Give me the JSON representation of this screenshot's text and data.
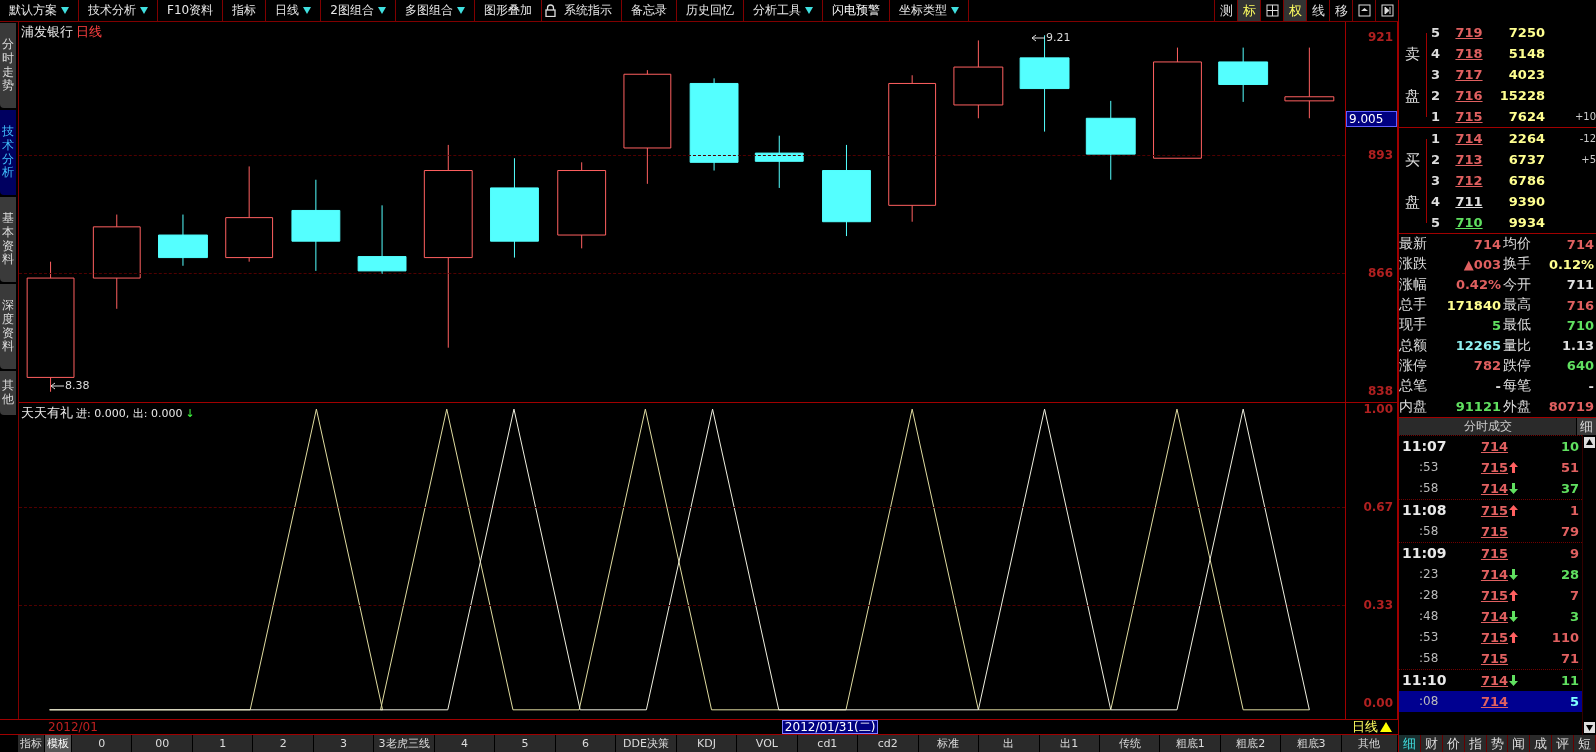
{
  "toolbar": {
    "items": [
      {
        "label": "默认方案",
        "dropdown": true
      },
      {
        "label": "技术分析",
        "dropdown": true
      },
      {
        "label": "F10资料",
        "dropdown": false
      },
      {
        "label": "指标",
        "dropdown": false
      },
      {
        "label": "日线",
        "dropdown": true
      },
      {
        "label": "2图组合",
        "dropdown": true
      },
      {
        "label": "多图组合",
        "dropdown": true
      },
      {
        "label": "图形叠加",
        "dropdown": false
      },
      {
        "label": "系统指示",
        "dropdown": false,
        "lock": true
      },
      {
        "label": "备忘录",
        "dropdown": false
      },
      {
        "label": "历史回忆",
        "dropdown": false
      },
      {
        "label": "分析工具",
        "dropdown": true
      },
      {
        "label": "闪电预警",
        "dropdown": false
      },
      {
        "label": "坐标类型",
        "dropdown": true
      }
    ],
    "right_buttons": [
      {
        "kind": "text",
        "label": "测",
        "selected": false
      },
      {
        "kind": "text",
        "label": "标",
        "selected": true
      },
      {
        "kind": "grid",
        "selected": false
      },
      {
        "kind": "text",
        "label": "权",
        "selected": true
      },
      {
        "kind": "text",
        "label": "线",
        "selected": false
      },
      {
        "kind": "text",
        "label": "移",
        "selected": false
      },
      {
        "kind": "window",
        "selected": false
      },
      {
        "kind": "end",
        "selected": false
      }
    ]
  },
  "side_tabs": [
    {
      "label": "分时走势",
      "selected": false
    },
    {
      "label": "技术分析",
      "selected": true
    },
    {
      "label": "基本资料",
      "selected": false
    },
    {
      "label": "深度资料",
      "selected": false
    },
    {
      "label": "其他",
      "selected": false
    }
  ],
  "price_chart": {
    "stock": "浦发银行",
    "period": "日线",
    "high_marker": "9.21",
    "low_marker": "8.38",
    "current_price": "9.005",
    "axis_labels": [
      "921",
      "893",
      "866",
      "838"
    ]
  },
  "indicator": {
    "name": "天天有礼",
    "legend": "进: 0.000, 出: 0.000",
    "trend_arrow": "↓",
    "axis_labels": [
      "1.00",
      "0.67",
      "0.33",
      "0.00"
    ]
  },
  "date_bar": {
    "start": "2012/01",
    "cursor": "2012/01/31(二)",
    "period": "日线"
  },
  "bottom_tabs": [
    {
      "label": "指标",
      "selected": false
    },
    {
      "label": "模板",
      "selected": true
    },
    {
      "label": "0",
      "selected": false
    },
    {
      "label": "00",
      "selected": false
    },
    {
      "label": "1",
      "selected": false
    },
    {
      "label": "2",
      "selected": false
    },
    {
      "label": "3",
      "selected": false
    },
    {
      "label": "3老虎三线",
      "selected": false
    },
    {
      "label": "4",
      "selected": false
    },
    {
      "label": "5",
      "selected": false
    },
    {
      "label": "6",
      "selected": false
    },
    {
      "label": "DDE决策",
      "selected": false
    },
    {
      "label": "KDJ",
      "selected": false
    },
    {
      "label": "VOL",
      "selected": false
    },
    {
      "label": "cd1",
      "selected": false
    },
    {
      "label": "cd2",
      "selected": false
    },
    {
      "label": "标准",
      "selected": false
    },
    {
      "label": "出",
      "selected": false
    },
    {
      "label": "出1",
      "selected": false
    },
    {
      "label": "传统",
      "selected": false
    },
    {
      "label": "粗底1",
      "selected": false
    },
    {
      "label": "粗底2",
      "selected": false
    },
    {
      "label": "粗底3",
      "selected": false
    },
    {
      "label": "其他",
      "selected": false
    }
  ],
  "order_book": {
    "sell_label": "卖盘",
    "buy_label": "买盘",
    "sell": [
      {
        "level": "5",
        "price": "719",
        "volume": "7250",
        "color": "#e06060"
      },
      {
        "level": "4",
        "price": "718",
        "volume": "5148",
        "color": "#e06060"
      },
      {
        "level": "3",
        "price": "717",
        "volume": "4023",
        "color": "#e06060"
      },
      {
        "level": "2",
        "price": "716",
        "volume": "15228",
        "color": "#e06060"
      },
      {
        "level": "1",
        "price": "715",
        "volume": "7624",
        "change": "+10",
        "color": "#e06060"
      }
    ],
    "buy": [
      {
        "level": "1",
        "price": "714",
        "volume": "2264",
        "change": "-12",
        "color": "#e06060"
      },
      {
        "level": "2",
        "price": "713",
        "volume": "6737",
        "change": "+5",
        "color": "#e06060"
      },
      {
        "level": "3",
        "price": "712",
        "volume": "6786",
        "color": "#e06060"
      },
      {
        "level": "4",
        "price": "711",
        "volume": "9390",
        "color": "#e0e0e0"
      },
      {
        "level": "5",
        "price": "710",
        "volume": "9934",
        "color": "#60e060"
      }
    ]
  },
  "quote": [
    [
      {
        "label": "最新",
        "value": "714",
        "color": "#e06060"
      },
      {
        "label": "均价",
        "value": "714",
        "color": "#e06060"
      }
    ],
    [
      {
        "label": "涨跌",
        "value": "▲003",
        "color": "#e06060"
      },
      {
        "label": "换手",
        "value": "0.12%",
        "color": "#ffff90"
      }
    ],
    [
      {
        "label": "涨幅",
        "value": "0.42%",
        "color": "#e06060"
      },
      {
        "label": "今开",
        "value": "711",
        "color": "#e0e0e0"
      }
    ],
    [
      {
        "label": "总手",
        "value": "171840",
        "color": "#ffff90"
      },
      {
        "label": "最高",
        "value": "716",
        "color": "#e06060"
      }
    ],
    [
      {
        "label": "现手",
        "value": "5",
        "color": "#60e060"
      },
      {
        "label": "最低",
        "value": "710",
        "color": "#60e060"
      }
    ],
    [
      {
        "label": "总额",
        "value": "12265",
        "color": "#90f0f0"
      },
      {
        "label": "量比",
        "value": "1.13",
        "color": "#e0e0e0"
      }
    ],
    [
      {
        "label": "涨停",
        "value": "782",
        "color": "#e06060"
      },
      {
        "label": "跌停",
        "value": "640",
        "color": "#60e060"
      }
    ],
    [
      {
        "label": "总笔",
        "value": "-",
        "color": "#e0e0e0"
      },
      {
        "label": "每笔",
        "value": "-",
        "color": "#e0e0e0"
      }
    ],
    [
      {
        "label": "内盘",
        "value": "91121",
        "color": "#60e060"
      },
      {
        "label": "外盘",
        "value": "80719",
        "color": "#e06060"
      }
    ]
  ],
  "trades": {
    "title": "分时成交",
    "detail_button": "细",
    "rows": [
      {
        "kind": "minute",
        "time": "11:07",
        "price": "714",
        "uptick": false,
        "downtick": false,
        "volume": "10",
        "color": "#60e060",
        "selected": false
      },
      {
        "kind": "second",
        "time": ":53",
        "price": "715",
        "uptick": true,
        "downtick": false,
        "volume": "51",
        "color": "#e06060",
        "selected": false
      },
      {
        "kind": "second",
        "time": ":58",
        "price": "714",
        "uptick": false,
        "downtick": true,
        "volume": "37",
        "color": "#60e060",
        "selected": false
      },
      {
        "kind": "minute",
        "time": "11:08",
        "price": "715",
        "uptick": true,
        "downtick": false,
        "volume": "1",
        "color": "#e06060",
        "selected": false
      },
      {
        "kind": "second",
        "time": ":58",
        "price": "715",
        "uptick": false,
        "downtick": false,
        "volume": "79",
        "color": "#e06060",
        "selected": false
      },
      {
        "kind": "minute",
        "time": "11:09",
        "price": "715",
        "uptick": false,
        "downtick": false,
        "volume": "9",
        "color": "#e06060",
        "selected": false
      },
      {
        "kind": "second",
        "time": ":23",
        "price": "714",
        "uptick": false,
        "downtick": true,
        "volume": "28",
        "color": "#60e060",
        "selected": false
      },
      {
        "kind": "second",
        "time": ":28",
        "price": "715",
        "uptick": true,
        "downtick": false,
        "volume": "7",
        "color": "#e06060",
        "selected": false
      },
      {
        "kind": "second",
        "time": ":48",
        "price": "714",
        "uptick": false,
        "downtick": true,
        "volume": "3",
        "color": "#60e060",
        "selected": false
      },
      {
        "kind": "second",
        "time": ":53",
        "price": "715",
        "uptick": true,
        "downtick": false,
        "volume": "110",
        "color": "#e06060",
        "selected": false
      },
      {
        "kind": "second",
        "time": ":58",
        "price": "715",
        "uptick": false,
        "downtick": false,
        "volume": "71",
        "color": "#e06060",
        "selected": false
      },
      {
        "kind": "minute",
        "time": "11:10",
        "price": "714",
        "uptick": false,
        "downtick": true,
        "volume": "11",
        "color": "#60e060",
        "selected": false
      },
      {
        "kind": "second",
        "time": ":08",
        "price": "714",
        "uptick": false,
        "downtick": false,
        "volume": "5",
        "color": "#80ffff",
        "selected": true
      }
    ]
  },
  "panel_tabs": [
    {
      "label": "细",
      "selected": true
    },
    {
      "label": "财",
      "selected": false
    },
    {
      "label": "价",
      "selected": false
    },
    {
      "label": "指",
      "selected": false
    },
    {
      "label": "势",
      "selected": false
    },
    {
      "label": "闻",
      "selected": false
    },
    {
      "label": "成",
      "selected": false
    },
    {
      "label": "评",
      "selected": false
    },
    {
      "label": "短",
      "selected": false
    }
  ]
}
